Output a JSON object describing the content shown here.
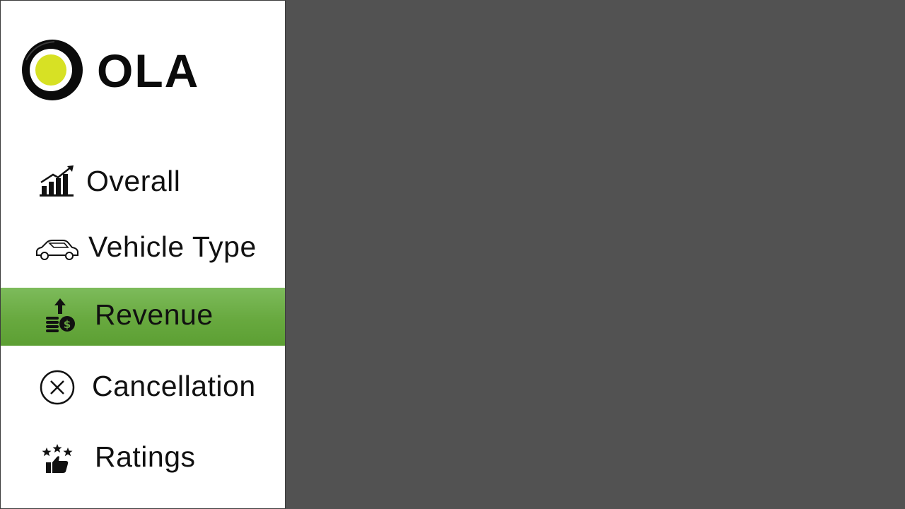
{
  "brand": {
    "name": "OLA",
    "accent_color": "#d7e124",
    "logo_icon": "ola-logo-icon"
  },
  "sidebar": {
    "active_color": "#6aaa42",
    "items": [
      {
        "label": "Overall",
        "icon": "bar-chart-growth-icon",
        "active": false
      },
      {
        "label": "Vehicle Type",
        "icon": "car-icon",
        "active": false
      },
      {
        "label": "Revenue",
        "icon": "money-growth-icon",
        "active": true
      },
      {
        "label": "Cancellation",
        "icon": "close-circle-icon",
        "active": false
      },
      {
        "label": "Ratings",
        "icon": "thumbs-up-stars-icon",
        "active": false
      }
    ]
  },
  "main": {
    "background_color": "#525252"
  }
}
